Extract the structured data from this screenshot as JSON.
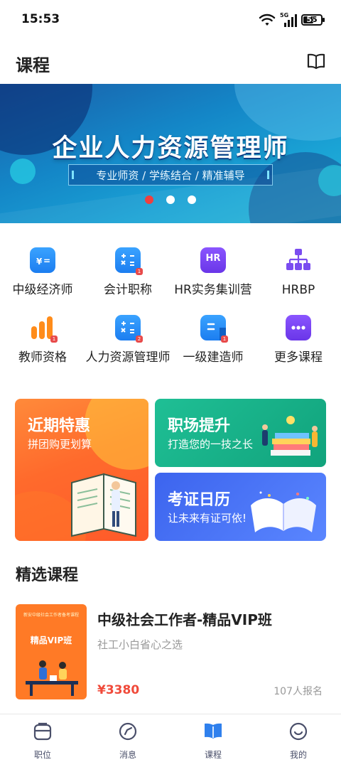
{
  "status_bar": {
    "time": "15:53",
    "network": "5G",
    "battery": "55"
  },
  "header": {
    "title": "课程",
    "book_icon": "book-open-icon"
  },
  "banner": {
    "headline": "企业人力资源管理师",
    "subtitle": "专业师资 / 学练结合 / 精准辅导",
    "page_count": 3,
    "active_page": 1
  },
  "categories": [
    {
      "label": "中级经济师",
      "icon": "calculator-yen-icon"
    },
    {
      "label": "会计职称",
      "icon": "calculator-icon"
    },
    {
      "label": "HR实务集训营",
      "icon": "hr-badge-icon",
      "icon_text": "HR"
    },
    {
      "label": "HRBP",
      "icon": "org-chart-icon"
    },
    {
      "label": "教师资格",
      "icon": "bar-chart-icon"
    },
    {
      "label": "人力资源管理师",
      "icon": "calculator-icon"
    },
    {
      "label": "一级建造师",
      "icon": "document-icon"
    },
    {
      "label": "更多课程",
      "icon": "more-dots-icon"
    }
  ],
  "promos": [
    {
      "title": "近期特惠",
      "subtitle": "拼团购更划算"
    },
    {
      "title": "职场提升",
      "subtitle": "打造您的一技之长"
    },
    {
      "title": "考证日历",
      "subtitle": "让未来有证可依!"
    }
  ],
  "featured": {
    "section_title": "精选课程",
    "course": {
      "thumb_small": "新安中级社会工作者备考课程",
      "thumb_label": "精品VIP班",
      "title": "中级社会工作者-精品VIP班",
      "subtitle": "社工小白省心之选",
      "price": "¥3380",
      "enrolled": "107人报名"
    }
  },
  "tabs": [
    {
      "label": "职位",
      "icon": "briefcase-icon"
    },
    {
      "label": "消息",
      "icon": "message-compass-icon"
    },
    {
      "label": "课程",
      "icon": "book-filled-icon",
      "active": true
    },
    {
      "label": "我的",
      "icon": "smile-face-icon"
    }
  ],
  "colors": {
    "accent": "#1c7df0",
    "price": "#f04a3a",
    "promo_orange": "#ff6a2c",
    "promo_green": "#11a37c",
    "promo_blue": "#3c64ee",
    "tab_active": "#2f80ed"
  }
}
